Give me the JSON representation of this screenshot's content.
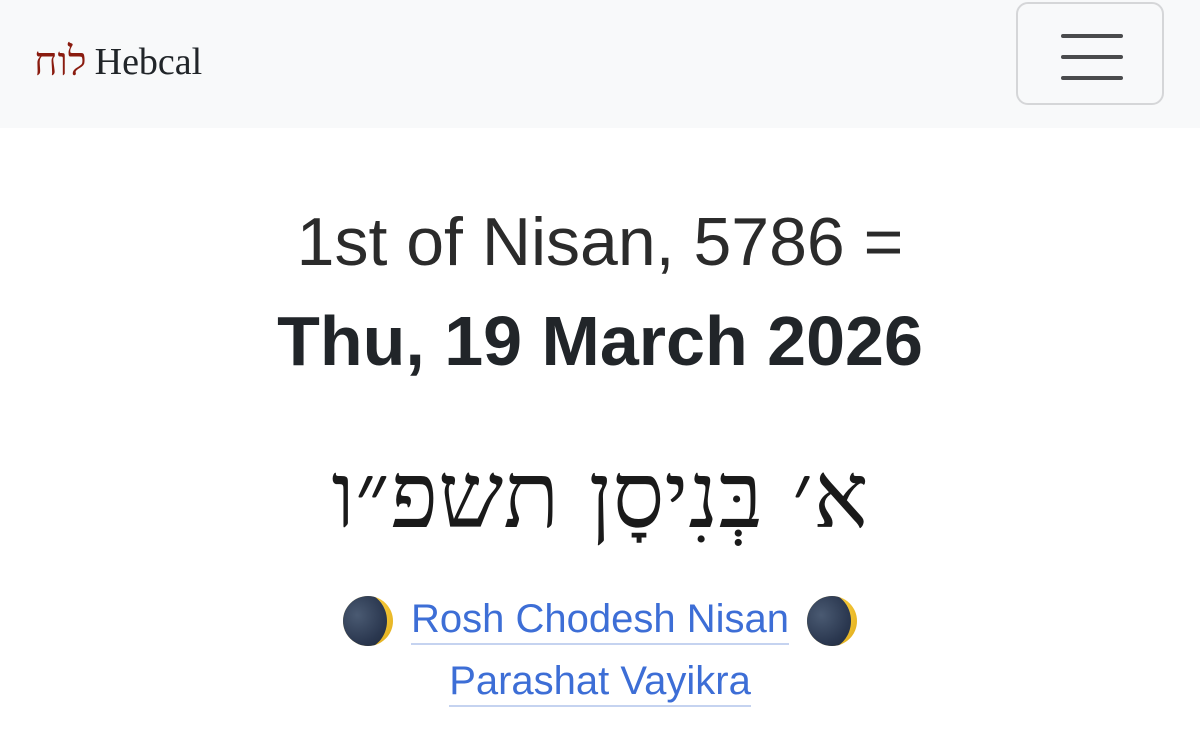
{
  "navbar": {
    "brand_hebrew": "לוח",
    "brand_name": "Hebcal",
    "menu_icon": "hamburger-menu-icon"
  },
  "date": {
    "hebrew_english": "1st of Nisan, 5786 =",
    "gregorian": "Thu, 19 March 2026",
    "hebrew": "א׳ בְּנִיסָן תשפ״ו"
  },
  "events": [
    {
      "label": "Rosh Chodesh Nisan",
      "icon": "new-moon-icon"
    },
    {
      "label": "Parashat Vayikra"
    }
  ],
  "colors": {
    "navbar_bg": "#f8f9fa",
    "brand_accent": "#8a1b0f",
    "link": "#3d6ed6",
    "text": "#212529"
  }
}
